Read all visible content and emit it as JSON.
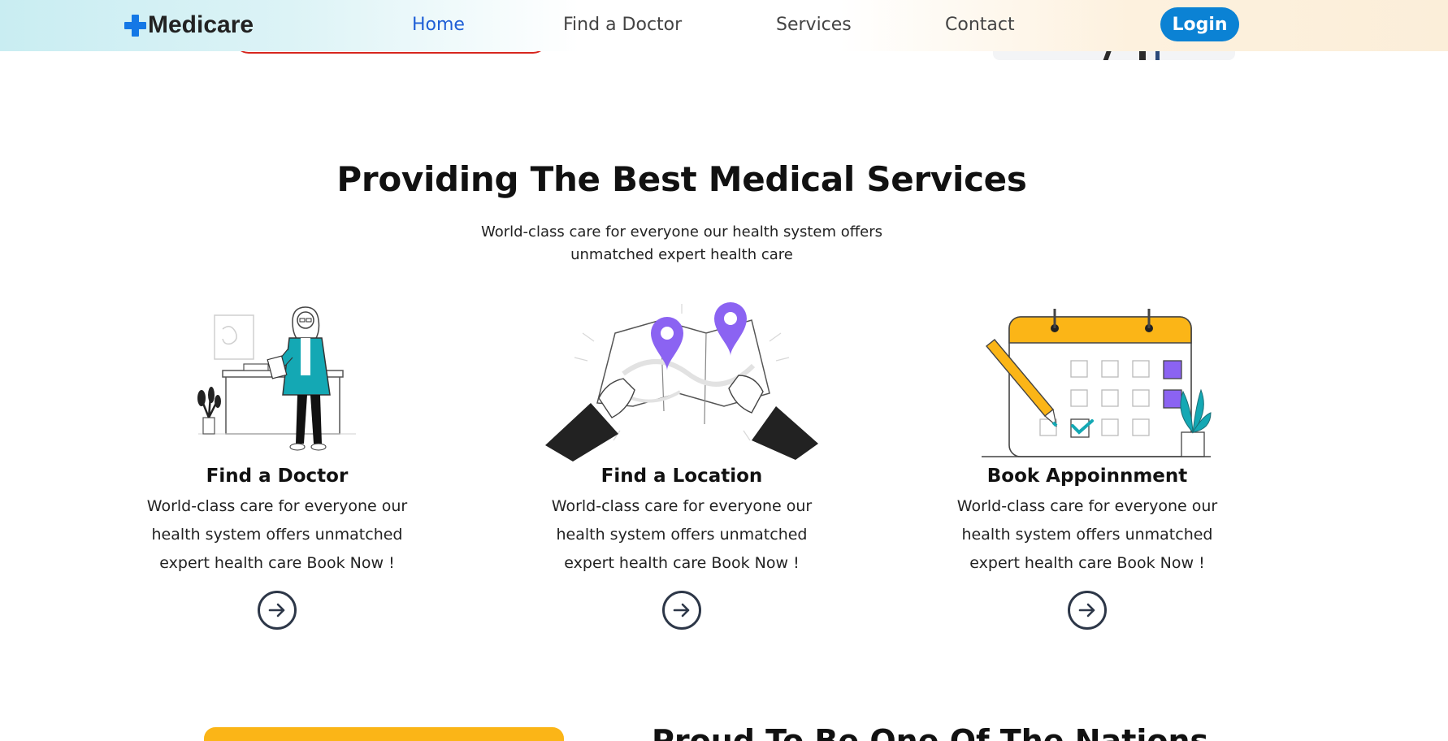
{
  "navbar": {
    "logo_text": "Medicare",
    "links": [
      {
        "label": "Home"
      },
      {
        "label": "Find a Doctor"
      },
      {
        "label": "Services"
      },
      {
        "label": "Contact"
      }
    ],
    "login_label": "Login"
  },
  "services": {
    "title": "Providing The Best Medical Services",
    "subtitle": "World-class care for everyone our health system offers unmatched expert health care",
    "cards": [
      {
        "title": "Find a Doctor",
        "description": "World-class care for everyone our health system offers unmatched expert health care Book Now !",
        "icon": "doctor-illustration"
      },
      {
        "title": "Find a Location",
        "description": "World-class care for everyone our health system offers unmatched expert health care Book Now !",
        "icon": "map-illustration"
      },
      {
        "title": "Book Appoinnment",
        "description": "World-class care for everyone our health system offers unmatched expert health care Book Now !",
        "icon": "calendar-illustration"
      }
    ]
  },
  "next_section": {
    "heading": "Proud To Be One Of The Nations"
  },
  "colors": {
    "brand_blue": "#1478e6",
    "active_link": "#1f5fd6",
    "login_bg": "#0b82d4",
    "accent_teal": "#14a8b4",
    "accent_purple": "#8b63f2",
    "accent_yellow": "#fbb517"
  }
}
